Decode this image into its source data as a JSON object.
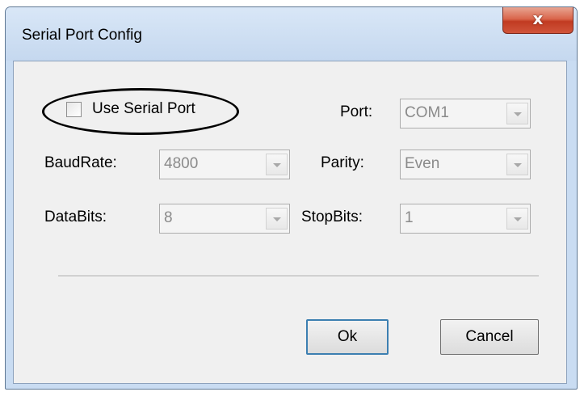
{
  "window": {
    "title": "Serial Port Config",
    "close_glyph": "x",
    "close_icon": "close-icon"
  },
  "use_serial_port": {
    "label": "Use Serial Port",
    "checked": false
  },
  "port": {
    "label": "Port:",
    "value": "COM1"
  },
  "baudrate": {
    "label": "BaudRate:",
    "value": "4800"
  },
  "parity": {
    "label": "Parity:",
    "value": "Even"
  },
  "databits": {
    "label": "DataBits:",
    "value": "8"
  },
  "stopbits": {
    "label": "StopBits:",
    "value": "1"
  },
  "buttons": {
    "ok": "Ok",
    "cancel": "Cancel"
  },
  "colors": {
    "client_bg": "#f0f0f0",
    "frame": "#c9dcf2",
    "close_red": "#c13b22",
    "default_button_border": "#3c7fb1",
    "disabled_text": "#8a8a8a"
  }
}
